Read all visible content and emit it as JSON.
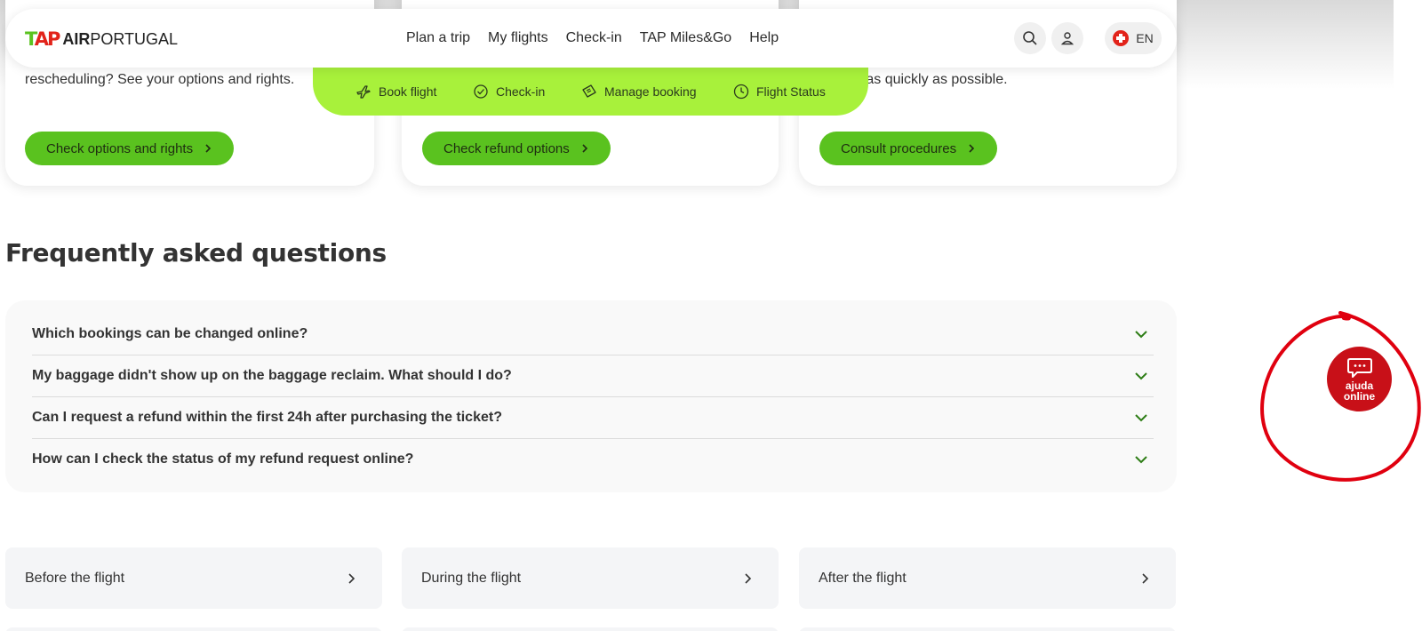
{
  "header": {
    "logo": {
      "mark_t": "T",
      "mark_a": "A",
      "mark_p": "P",
      "word_air": "AIR",
      "word_portugal": "PORTUGAL"
    },
    "nav": [
      "Plan a trip",
      "My flights",
      "Check-in",
      "TAP Miles&Go",
      "Help"
    ],
    "icons": {
      "search": "search-icon",
      "account": "user-icon",
      "language_flag": "switzerland-flag-icon"
    },
    "language": "EN"
  },
  "quickbar": {
    "items": [
      {
        "label": "Book flight",
        "icon": "plane-icon"
      },
      {
        "label": "Check-in",
        "icon": "check-circle-icon"
      },
      {
        "label": "Manage booking",
        "icon": "ticket-icon"
      },
      {
        "label": "Flight Status",
        "icon": "clock-icon"
      }
    ]
  },
  "cards": [
    {
      "text": "rescheduling? See your options and rights.",
      "button": "Check options and rights"
    },
    {
      "text": "",
      "button": "Check refund options"
    },
    {
      "text": "n as quickly as possible.",
      "button": "Consult procedures"
    }
  ],
  "faq": {
    "title": "Frequently asked questions",
    "items": [
      "Which bookings can be changed online?",
      "My baggage didn't show up on the baggage reclaim. What should I do?",
      "Can I request a refund within the first 24h after purchasing the ticket?",
      "How can I check the status of my refund request online?"
    ]
  },
  "links": [
    "Before the flight",
    "During the flight",
    "After the flight"
  ],
  "chat": {
    "line1": "ajuda",
    "line2": "online",
    "icon": "chat-bubble-icon"
  },
  "colors": {
    "brand_green": "#5ac21f",
    "quickbar_lime": "#a8f13b",
    "tap_red": "#e2231a",
    "chat_red": "#c81018",
    "annotation_red": "#e0000f"
  }
}
